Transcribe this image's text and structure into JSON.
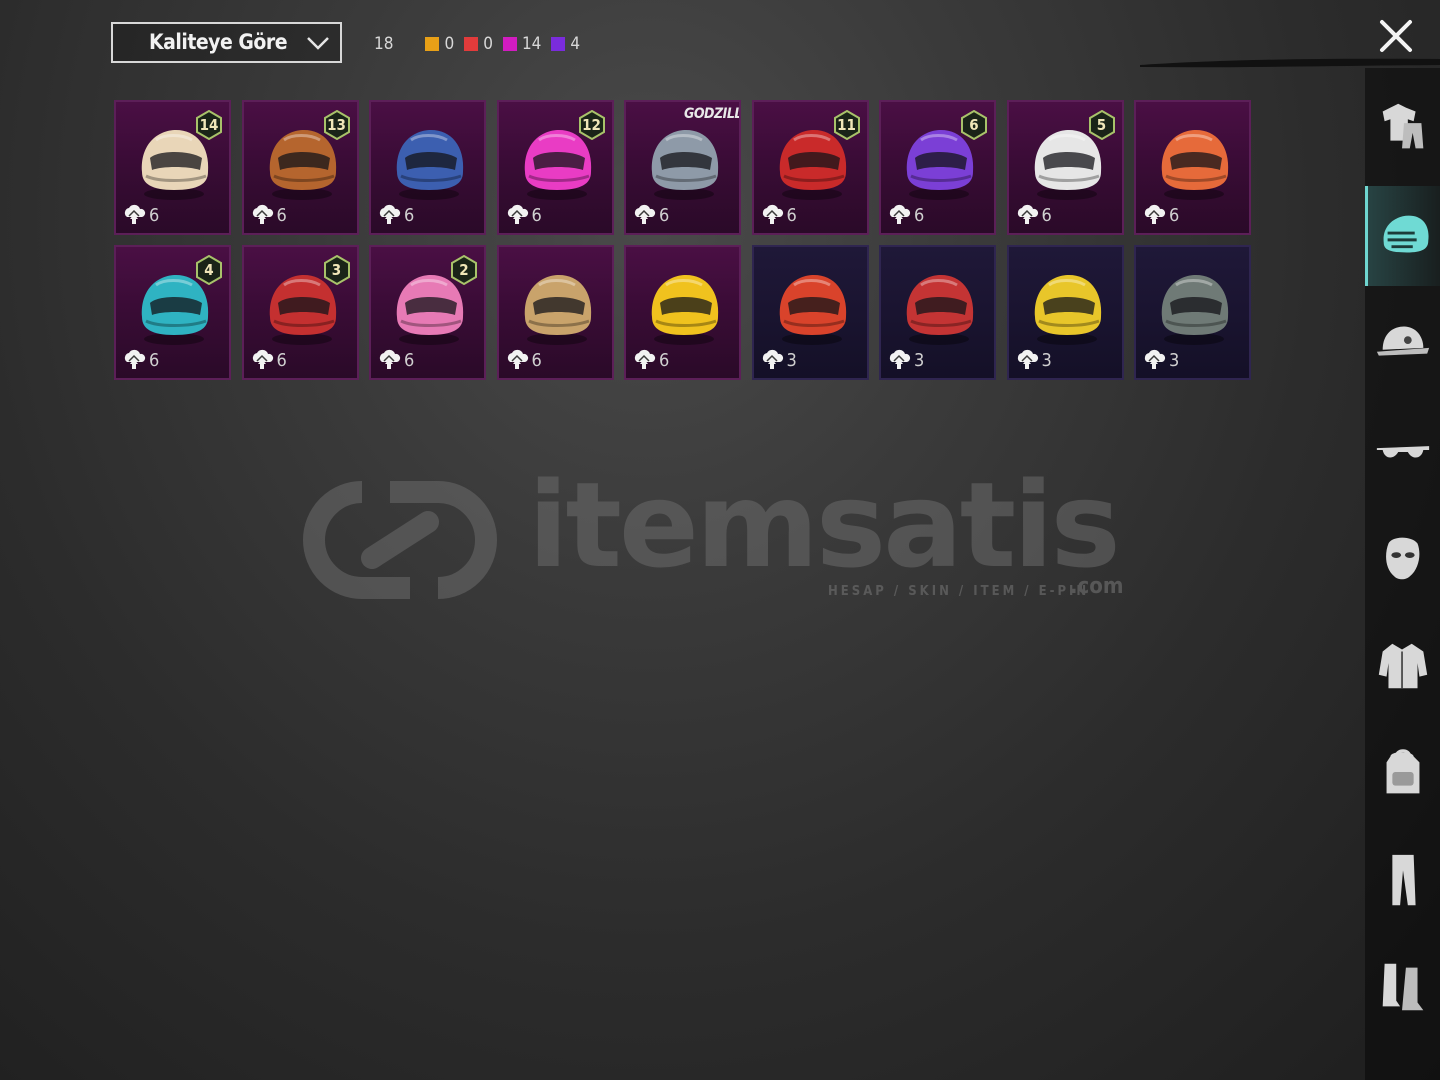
{
  "toolbar": {
    "sort_label": "Kaliteye Göre",
    "total_count": "18",
    "quality_counts": [
      {
        "color": "#e8a017",
        "count": "0"
      },
      {
        "color": "#e23b3b",
        "count": "0"
      },
      {
        "color": "#d21cc0",
        "count": "14"
      },
      {
        "color": "#7a2cdc",
        "count": "4"
      }
    ]
  },
  "watermark": {
    "brand": "itemsatis",
    "tagline": "HESAP / SKIN / ITEM / E-PIN",
    "domain": ".com"
  },
  "items": [
    {
      "level": "14",
      "upgrade": "6",
      "rarity": "epic",
      "accent": "#e9d6b8",
      "banner": ""
    },
    {
      "level": "13",
      "upgrade": "6",
      "rarity": "epic",
      "accent": "#b5652e",
      "banner": ""
    },
    {
      "level": "",
      "upgrade": "6",
      "rarity": "epic",
      "accent": "#3c5fb0",
      "banner": ""
    },
    {
      "level": "12",
      "upgrade": "6",
      "rarity": "epic",
      "accent": "#e93cc4",
      "banner": ""
    },
    {
      "level": "",
      "upgrade": "6",
      "rarity": "epic",
      "accent": "#8e9aa8",
      "banner": "GODZILLA"
    },
    {
      "level": "11",
      "upgrade": "6",
      "rarity": "epic",
      "accent": "#c92a2a",
      "banner": ""
    },
    {
      "level": "6",
      "upgrade": "6",
      "rarity": "epic",
      "accent": "#7b3fd6",
      "banner": ""
    },
    {
      "level": "5",
      "upgrade": "6",
      "rarity": "epic",
      "accent": "#e6e6e6",
      "banner": ""
    },
    {
      "level": "",
      "upgrade": "6",
      "rarity": "epic",
      "accent": "#e66a3a",
      "banner": ""
    },
    {
      "level": "4",
      "upgrade": "6",
      "rarity": "epic",
      "accent": "#2fb3c2",
      "banner": ""
    },
    {
      "level": "3",
      "upgrade": "6",
      "rarity": "epic",
      "accent": "#c43030",
      "banner": ""
    },
    {
      "level": "2",
      "upgrade": "6",
      "rarity": "epic",
      "accent": "#e77ab5",
      "banner": ""
    },
    {
      "level": "",
      "upgrade": "6",
      "rarity": "epic",
      "accent": "#c9a36b",
      "banner": ""
    },
    {
      "level": "",
      "upgrade": "6",
      "rarity": "epic",
      "accent": "#f0c21e",
      "banner": ""
    },
    {
      "level": "",
      "upgrade": "3",
      "rarity": "rare",
      "accent": "#d9432b",
      "banner": ""
    },
    {
      "level": "",
      "upgrade": "3",
      "rarity": "rare",
      "accent": "#c43434",
      "banner": ""
    },
    {
      "level": "",
      "upgrade": "3",
      "rarity": "rare",
      "accent": "#e8c62a",
      "banner": ""
    },
    {
      "level": "",
      "upgrade": "3",
      "rarity": "rare",
      "accent": "#6f7a76",
      "banner": ""
    }
  ],
  "sidebar": {
    "categories": [
      {
        "icon": "outfit-icon",
        "active": false
      },
      {
        "icon": "helmet-icon",
        "active": true
      },
      {
        "icon": "cap-icon",
        "active": false
      },
      {
        "icon": "glasses-icon",
        "active": false
      },
      {
        "icon": "mask-icon",
        "active": false
      },
      {
        "icon": "jacket-icon",
        "active": false
      },
      {
        "icon": "backpack-icon",
        "active": false
      },
      {
        "icon": "pants-icon",
        "active": false
      },
      {
        "icon": "boots-icon",
        "active": false
      }
    ]
  }
}
